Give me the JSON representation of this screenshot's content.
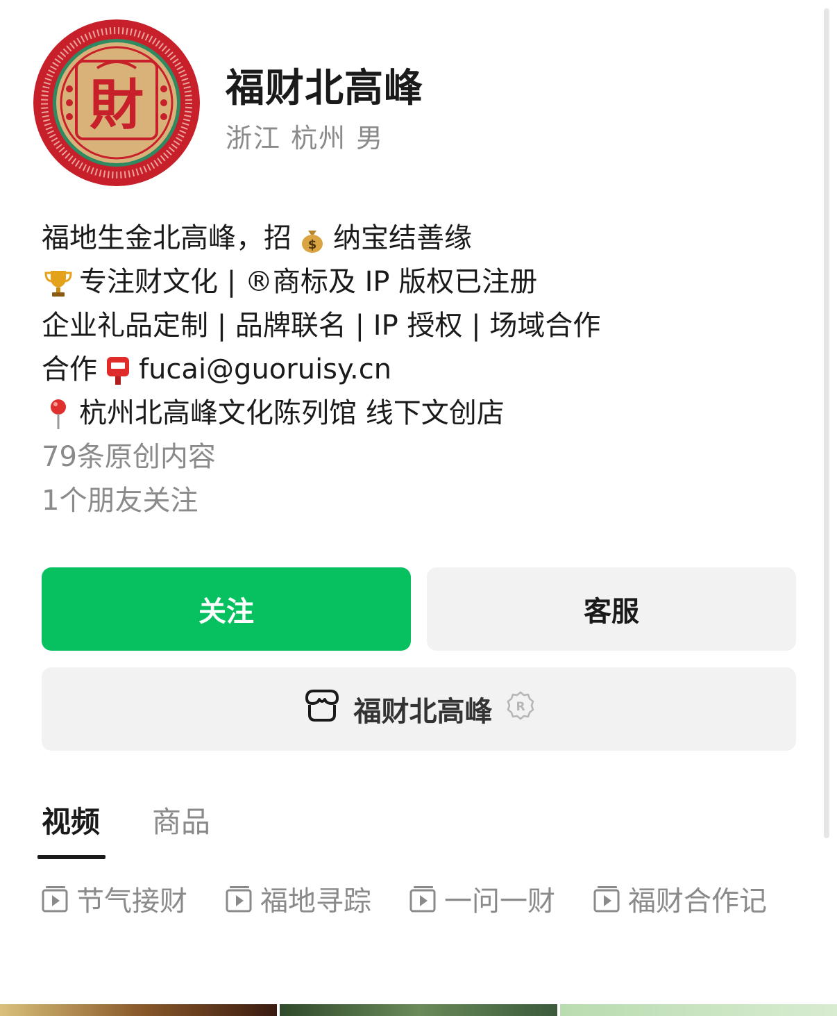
{
  "profile": {
    "name": "福财北高峰",
    "meta": "浙江 杭州 男",
    "avatar_text": "財"
  },
  "bio": {
    "line1_a": "福地生金北高峰，招",
    "line1_b": "纳宝结善缘",
    "line2": "专注财文化 | ®商标及 IP 版权已注册",
    "line3": "企业礼品定制 | 品牌联名 | IP 授权 | 场域合作",
    "line4_a": "合作",
    "line4_b": "fucai@guoruisy.cn",
    "line5": "杭州北高峰文化陈列馆 线下文创店",
    "original_count": "79条原创内容",
    "friends_following": "1个朋友关注"
  },
  "actions": {
    "follow_label": "关注",
    "service_label": "客服",
    "shop_label": "福财北高峰"
  },
  "tabs": {
    "videos": "视频",
    "products": "商品"
  },
  "collections": [
    "节气接财",
    "福地寻踪",
    "一问一财",
    "福财合作记"
  ],
  "colors": {
    "brand_green": "#07c160",
    "avatar_red": "#c8202a",
    "avatar_gold": "#d9b27a",
    "muted_text": "#8a8a8a"
  },
  "icons": {
    "money_bag": "money-bag-icon",
    "trophy": "trophy-icon",
    "postbox": "postbox-icon",
    "pin": "location-pin-icon",
    "shop": "shop-icon",
    "registered": "registered-badge-icon",
    "collection": "playlist-icon"
  }
}
